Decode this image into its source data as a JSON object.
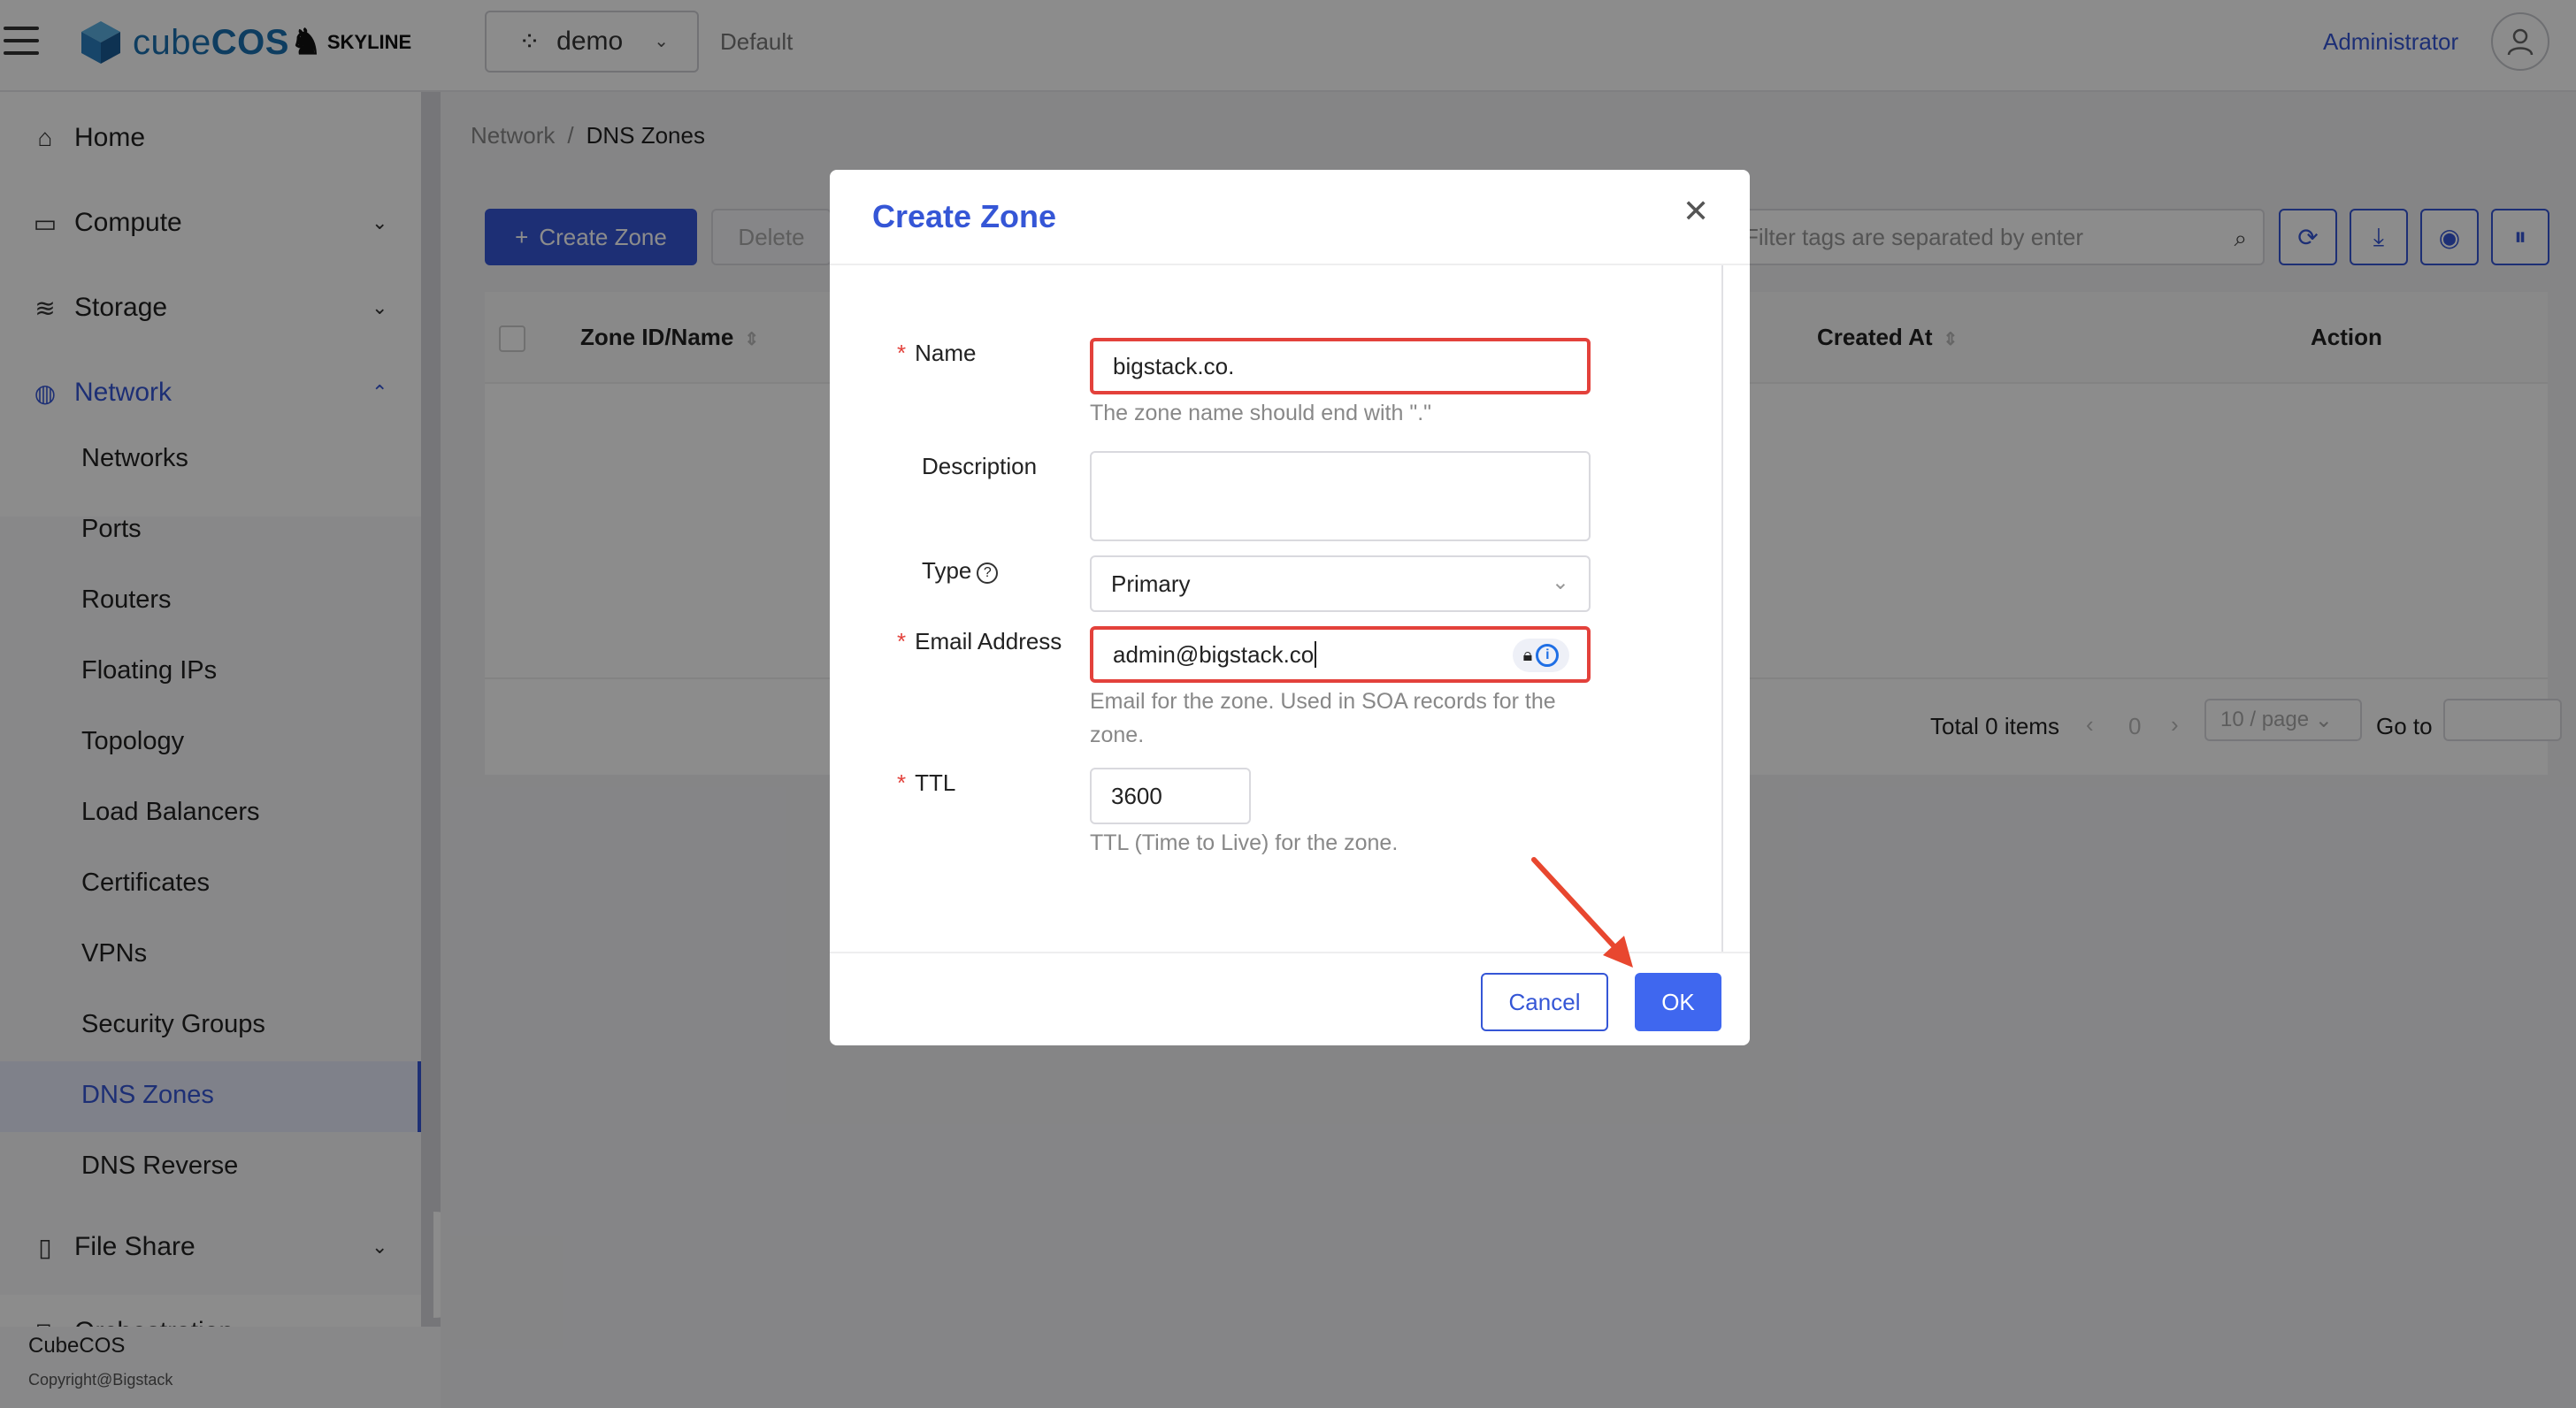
{
  "header": {
    "brand": "cubeCOS",
    "brand_a": "cube",
    "brand_b": "COS",
    "partner": "SKYLINE",
    "project": "demo",
    "domain": "Default",
    "user": "Administrator"
  },
  "sidebar": {
    "items": [
      {
        "label": "Home",
        "icon": "home-icon"
      },
      {
        "label": "Compute",
        "icon": "monitor-icon"
      },
      {
        "label": "Storage",
        "icon": "database-icon"
      },
      {
        "label": "Network",
        "icon": "globe-icon"
      },
      {
        "label": "File Share",
        "icon": "file-icon"
      },
      {
        "label": "Orchestration",
        "icon": "orchestration-icon"
      }
    ],
    "network_sub": [
      "Networks",
      "Ports",
      "Routers",
      "Floating IPs",
      "Topology",
      "Load Balancers",
      "Certificates",
      "VPNs",
      "Security Groups",
      "DNS Zones",
      "DNS Reverse"
    ],
    "selected": "DNS Zones"
  },
  "footer": {
    "brand": "CubeCOS",
    "copyright": "Copyright@Bigstack"
  },
  "breadcrumb": {
    "parent": "Network",
    "current": "DNS Zones"
  },
  "toolbar": {
    "create_label": "Create Zone",
    "delete_label": "Delete",
    "search_placeholder": "Filter tags are separated by enter"
  },
  "table": {
    "columns": [
      "Zone ID/Name",
      "Created At",
      "Action"
    ]
  },
  "pager": {
    "total": "Total 0 items",
    "page": "0",
    "page_size": "10 / page",
    "goto": "Go to"
  },
  "modal": {
    "title": "Create Zone",
    "fields": {
      "name_label": "Name",
      "name_value": "bigstack.co.",
      "name_hint": "The zone name should end with \".\"",
      "description_label": "Description",
      "type_label": "Type",
      "type_value": "Primary",
      "email_label": "Email Address",
      "email_value": "admin@bigstack.co",
      "email_hint": "Email for the zone. Used in SOA records for the zone.",
      "ttl_label": "TTL",
      "ttl_value": "3600",
      "ttl_hint": "TTL (Time to Live) for the zone."
    },
    "cancel_label": "Cancel",
    "ok_label": "OK"
  },
  "colors": {
    "accent": "#3556d6",
    "error": "#e3413b",
    "annotation": "#e8472f"
  }
}
